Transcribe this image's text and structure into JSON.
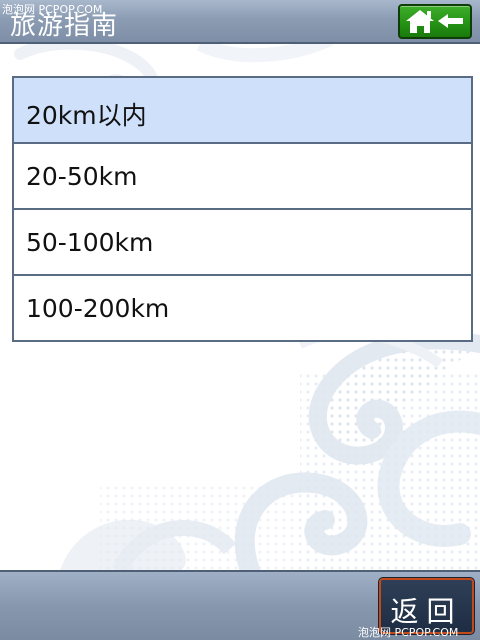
{
  "watermark_top": "泡泡网 PCPOP.COM",
  "header": {
    "title": "旅游指南",
    "home_icon": "home-back-icon",
    "home_color": "#239013"
  },
  "list": {
    "items": [
      {
        "label": "20km以内",
        "selected": true
      },
      {
        "label": "20-50km",
        "selected": false
      },
      {
        "label": "50-100km",
        "selected": false
      },
      {
        "label": "100-200km",
        "selected": false
      }
    ],
    "selected_color": "#cfe0fa"
  },
  "footer": {
    "back_label": "返回",
    "watermark": "泡泡网 PCPOP.COM"
  }
}
